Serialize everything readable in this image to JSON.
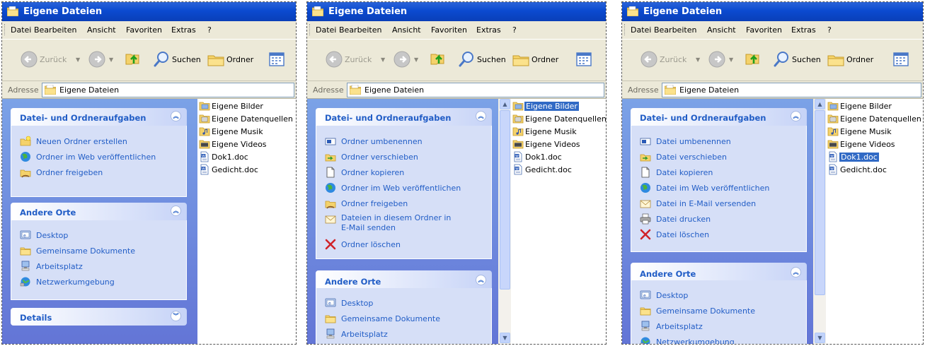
{
  "windows": [
    {
      "title": "Eigene Dateien",
      "menu": [
        "Datei",
        "Bearbeiten",
        "Ansicht",
        "Favoriten",
        "Extras",
        "?"
      ],
      "toolbar": {
        "back": "Zurück",
        "search": "Suchen",
        "folders": "Ordner"
      },
      "address": {
        "label": "Adresse",
        "value": "Eigene Dateien"
      },
      "panels": [
        {
          "title": "Datei- und Ordneraufgaben",
          "state": "expanded",
          "tasks": [
            "Neuen Ordner erstellen",
            "Ordner im Web veröffentlichen",
            "Ordner freigeben"
          ]
        },
        {
          "title": "Andere Orte",
          "state": "expanded",
          "tasks": [
            "Desktop",
            "Gemeinsame Dokumente",
            "Arbeitsplatz",
            "Netzwerkumgebung"
          ]
        },
        {
          "title": "Details",
          "state": "collapsed",
          "tasks": []
        }
      ],
      "files": [
        "Eigene Bilder",
        "Eigene Datenquellen",
        "Eigene Musik",
        "Eigene Videos",
        "Dok1.doc",
        "Gedicht.doc"
      ],
      "selected_file": null
    },
    {
      "title": "Eigene Dateien",
      "menu": [
        "Datei",
        "Bearbeiten",
        "Ansicht",
        "Favoriten",
        "Extras",
        "?"
      ],
      "toolbar": {
        "back": "Zurück",
        "search": "Suchen",
        "folders": "Ordner"
      },
      "address": {
        "label": "Adresse",
        "value": "Eigene Dateien"
      },
      "panels": [
        {
          "title": "Datei- und Ordneraufgaben",
          "state": "expanded",
          "tasks": [
            "Ordner umbenennen",
            "Ordner verschieben",
            "Ordner kopieren",
            "Ordner im Web veröffentlichen",
            "Ordner freigeben",
            "Dateien in diesem Ordner in",
            "E-Mail senden",
            "Ordner löschen"
          ]
        },
        {
          "title": "Andere Orte",
          "state": "expanded",
          "tasks": [
            "Desktop",
            "Gemeinsame Dokumente",
            "Arbeitsplatz"
          ]
        }
      ],
      "files": [
        "Eigene Bilder",
        "Eigene Datenquellen",
        "Eigene Musik",
        "Eigene Videos",
        "Dok1.doc",
        "Gedicht.doc"
      ],
      "selected_file": "Eigene Bilder"
    },
    {
      "title": "Eigene Dateien",
      "menu": [
        "Datei",
        "Bearbeiten",
        "Ansicht",
        "Favoriten",
        "Extras",
        "?"
      ],
      "toolbar": {
        "back": "Zurück",
        "search": "Suchen",
        "folders": "Ordner"
      },
      "address": {
        "label": "Adresse",
        "value": "Eigene Dateien"
      },
      "panels": [
        {
          "title": "Datei- und Ordneraufgaben",
          "state": "expanded",
          "tasks": [
            "Datei umbenennen",
            "Datei verschieben",
            "Datei kopieren",
            "Datei im Web veröffentlichen",
            "Datei in E-Mail versenden",
            "Datei drucken",
            "Datei löschen"
          ]
        },
        {
          "title": "Andere Orte",
          "state": "expanded",
          "tasks": [
            "Desktop",
            "Gemeinsame Dokumente",
            "Arbeitsplatz",
            "Netzwerkumgebung"
          ]
        }
      ],
      "files": [
        "Eigene Bilder",
        "Eigene Datenquellen",
        "Eigene Musik",
        "Eigene Videos",
        "Dok1.doc",
        "Gedicht.doc"
      ],
      "selected_file": "Dok1.doc"
    }
  ],
  "colors": {
    "titlebar": "#0b4ad0",
    "taskpane": "#6375d6",
    "link": "#215dc6",
    "selection": "#316ac5"
  }
}
